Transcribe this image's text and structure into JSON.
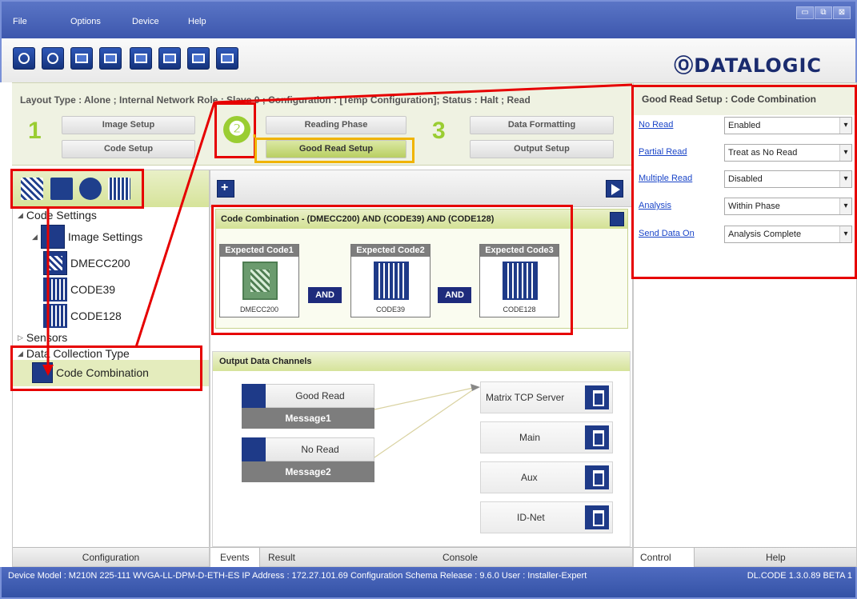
{
  "menu": {
    "items": [
      "File",
      "Options",
      "Device",
      "Help"
    ]
  },
  "window_controls": {
    "minimize": "▭",
    "restore": "⧉",
    "close": "⊠"
  },
  "toolbar": {
    "logo": "ⓄDATALOGIC",
    "icons": [
      "crosshair-icon",
      "capture-icon",
      "device-search-icon",
      "save-device-icon",
      "open-file-icon",
      "save-file-icon",
      "export-icon",
      "settings-list-icon"
    ]
  },
  "layout_line": "Layout Type : Alone ; Internal Network Role : Slave 0 ; Configuration : [Temp Configuration]; Status : Halt ; Read",
  "steps": {
    "step1": "1",
    "step2": "❷",
    "step3": "3",
    "image_setup": "Image Setup",
    "code_setup": "Code Setup",
    "reading_phase": "Reading Phase",
    "good_read_setup": "Good Read Setup",
    "data_formatting": "Data Formatting",
    "output_setup": "Output Setup"
  },
  "tree": {
    "code_settings": "Code Settings",
    "image_settings": "Image Settings",
    "codes": [
      "DMECC200",
      "CODE39",
      "CODE128"
    ],
    "sensors": "Sensors",
    "data_collection_type": "Data Collection Type",
    "code_combination": "Code Combination",
    "tab": "Configuration"
  },
  "code_combination": {
    "title": "Code Combination  -  (DMECC200) AND (CODE39) AND (CODE128)",
    "expected": [
      {
        "header": "Expected Code1",
        "label": "DMECC200"
      },
      {
        "header": "Expected Code2",
        "label": "CODE39"
      },
      {
        "header": "Expected Code3",
        "label": "CODE128"
      }
    ],
    "and_label": "AND"
  },
  "output_channels": {
    "title": "Output Data Channels",
    "events": [
      {
        "name": "Good Read",
        "message": "Message1"
      },
      {
        "name": "No Read",
        "message": "Message2"
      }
    ],
    "channels": [
      "Matrix TCP Server",
      "Main",
      "Aux",
      "ID-Net"
    ]
  },
  "center_tabs": [
    "Events",
    "Result",
    "Console"
  ],
  "good_read_setup": {
    "title": "Good Read Setup : Code Combination",
    "params": [
      {
        "label": "No Read",
        "value": "Enabled"
      },
      {
        "label": "Partial Read",
        "value": "Treat as No Read"
      },
      {
        "label": "Multiple Read",
        "value": "Disabled"
      },
      {
        "label": "Analysis",
        "value": "Within Phase"
      },
      {
        "label": "Send Data On",
        "value": "Analysis Complete"
      }
    ],
    "tabs": [
      "Control",
      "Help"
    ]
  },
  "status_bar": {
    "left": "Device Model : M210N 225-111 WVGA-LL-DPM-D-ETH-ES   IP Address : 172.27.101.69   Configuration Schema Release : 9.6.0   User : Installer-Expert",
    "right": "DL.CODE 1.3.0.89 BETA 1"
  },
  "colors": {
    "accent_green": "#9acd32",
    "brand_blue": "#1e3a88",
    "annotation_red": "#e60000",
    "annotation_orange": "#f0b400"
  }
}
